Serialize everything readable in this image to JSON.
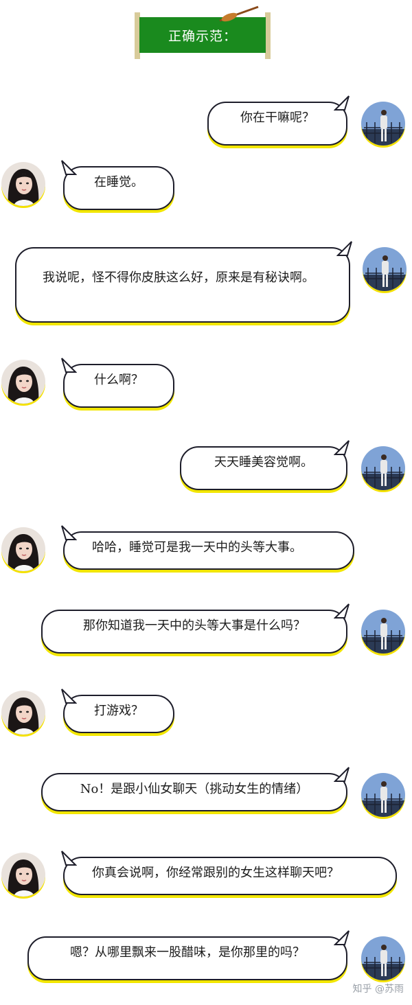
{
  "banner": {
    "title": "正确示范："
  },
  "messages": [
    {
      "side": "right",
      "text": "你在干嘛呢？"
    },
    {
      "side": "left",
      "text": "在睡觉。"
    },
    {
      "side": "right",
      "text": "我说呢，怪不得你皮肤这么好，原来是有秘诀啊。"
    },
    {
      "side": "left",
      "text": "什么啊？"
    },
    {
      "side": "right",
      "text": "天天睡美容觉啊。"
    },
    {
      "side": "left",
      "text": "哈哈，睡觉可是我一天中的头等大事。"
    },
    {
      "side": "right",
      "text": "那你知道我一天中的头等大事是什么吗？"
    },
    {
      "side": "left",
      "text": "打游戏？"
    },
    {
      "side": "right",
      "text": "No！是跟小仙女聊天（挑动女生的情绪）"
    },
    {
      "side": "left",
      "text": "你真会说啊，你经常跟别的女生这样聊天吧？"
    },
    {
      "side": "right",
      "text": "嗯？从哪里飘来一股醋味，是你那里的吗？"
    }
  ],
  "avatars": {
    "left": "female-user-avatar",
    "right": "male-user-avatar"
  },
  "watermark": "知乎 @苏雨",
  "colors": {
    "banner_green": "#1a8a1e",
    "bubble_border": "#1d1d2a",
    "bubble_shadow": "#f2e600"
  }
}
